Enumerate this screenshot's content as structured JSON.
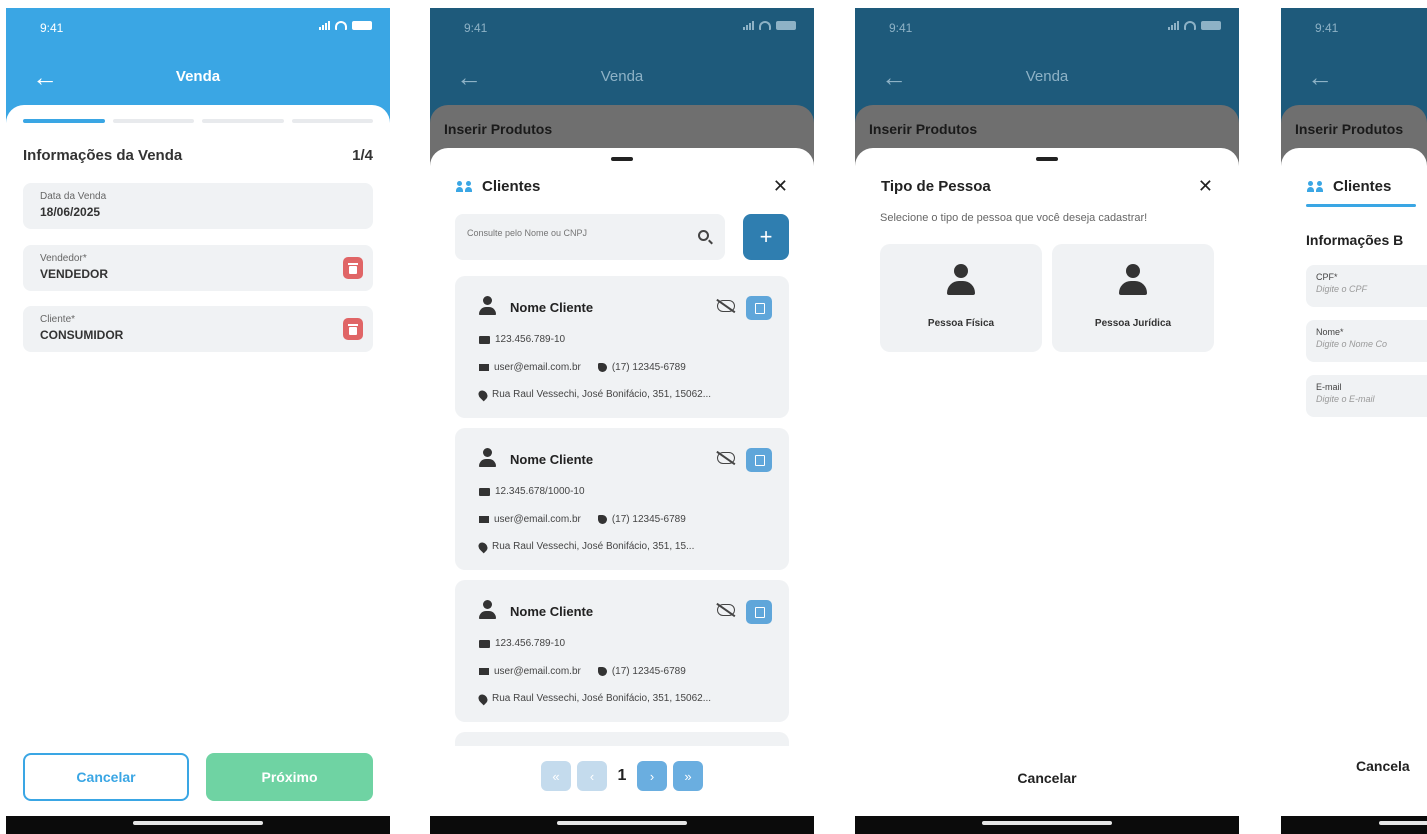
{
  "status": {
    "time": "9:41"
  },
  "colors": {
    "primary": "#3aa6e4",
    "primary_dark": "#1e5a7b",
    "success": "#6fd3a3",
    "danger": "#e06566"
  },
  "screen1": {
    "title": "Venda",
    "section_title": "Informações da Venda",
    "step": "1/4",
    "fields": [
      {
        "label": "Data da Venda",
        "value": "18/06/2025"
      },
      {
        "label": "Vendedor*",
        "value": "VENDEDOR"
      },
      {
        "label": "Cliente*",
        "value": "CONSUMIDOR"
      }
    ],
    "cancel": "Cancelar",
    "next": "Próximo"
  },
  "screen2": {
    "title": "Venda",
    "behind": "Inserir Produtos",
    "modal_title": "Clientes",
    "close": "✕",
    "search_placeholder": "Consulte pelo Nome ou CNPJ",
    "add": "+",
    "clients": [
      {
        "name": "Nome Cliente",
        "doc": "123.456.789-10",
        "email": "user@email.com.br",
        "phone": "(17) 12345-6789",
        "address": "Rua Raul Vessechi, José Bonifácio, 351, 15062..."
      },
      {
        "name": "Nome Cliente",
        "doc": "12.345.678/1000-10",
        "email": "user@email.com.br",
        "phone": "(17) 12345-6789",
        "address": "Rua Raul Vessechi, José Bonifácio, 351, 15..."
      },
      {
        "name": "Nome Cliente",
        "doc": "123.456.789-10",
        "email": "user@email.com.br",
        "phone": "(17) 12345-6789",
        "address": "Rua Raul Vessechi, José Bonifácio, 351, 15062..."
      }
    ],
    "pager": {
      "first": "«",
      "prev": "‹",
      "page": "1",
      "next": "›",
      "last": "»"
    }
  },
  "screen3": {
    "title": "Venda",
    "behind": "Inserir Produtos",
    "modal_title": "Tipo de Pessoa",
    "close": "✕",
    "subtitle": "Selecione o tipo de pessoa que você deseja cadastrar!",
    "options": [
      "Pessoa Física",
      "Pessoa Jurídica"
    ],
    "cancel": "Cancelar"
  },
  "screen4": {
    "behind": "Inserir Produtos",
    "tab": "Clientes",
    "section": "Informações B",
    "fields": [
      {
        "label": "CPF*",
        "placeholder": "Digite o CPF"
      },
      {
        "label": "Nome*",
        "placeholder": "Digite o Nome Co"
      },
      {
        "label": "E-mail",
        "placeholder": "Digite o E-mail"
      }
    ],
    "cancel": "Cancela"
  }
}
